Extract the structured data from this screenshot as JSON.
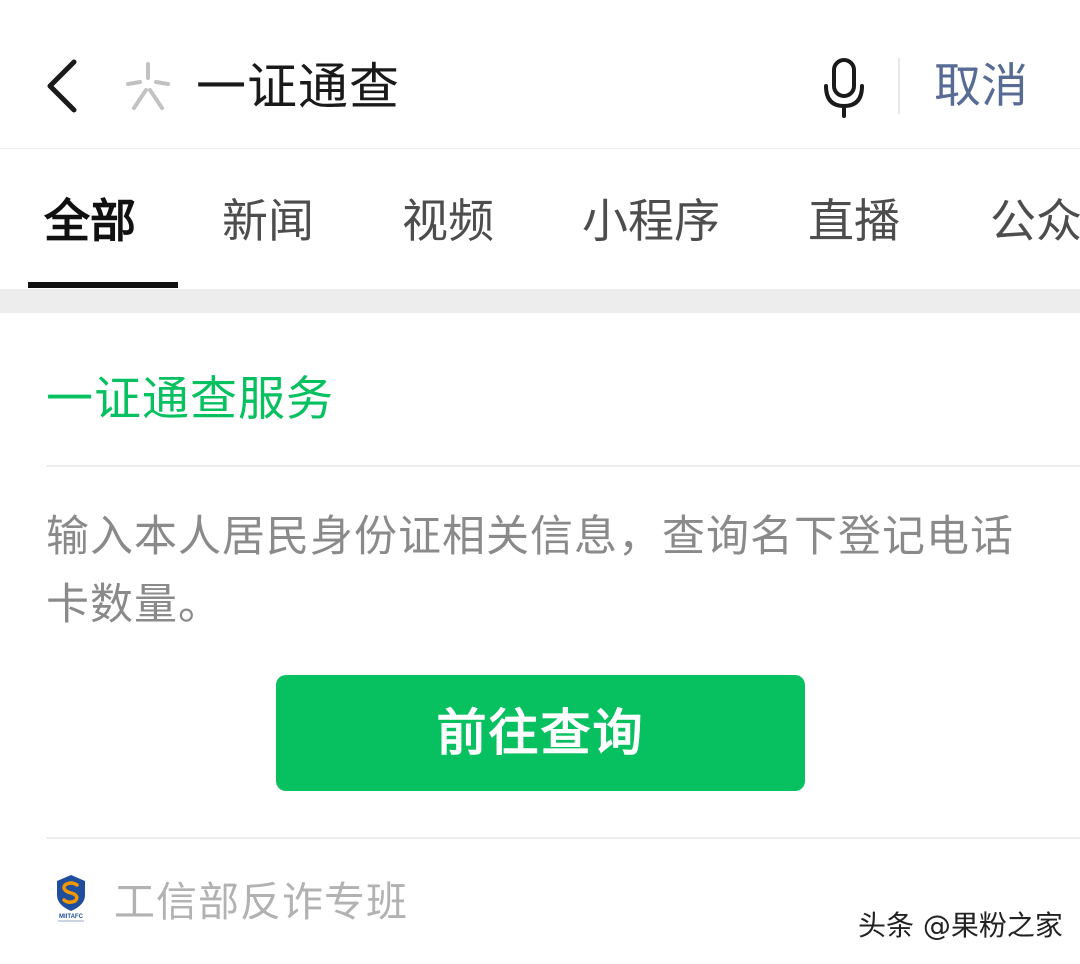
{
  "search": {
    "query": "一证通查",
    "cancel_label": "取消",
    "icons": {
      "back": "chevron-left-icon",
      "logo": "wechat-search-logo-icon",
      "mic": "microphone-icon"
    }
  },
  "tabs": [
    {
      "label": "全部",
      "active": true
    },
    {
      "label": "新闻",
      "active": false
    },
    {
      "label": "视频",
      "active": false
    },
    {
      "label": "小程序",
      "active": false
    },
    {
      "label": "直播",
      "active": false
    },
    {
      "label": "公众号",
      "active": false
    }
  ],
  "service_card": {
    "title": "一证通查服务",
    "description": "输入本人居民身份证相关信息，查询名下登记电话卡数量。",
    "button_label": "前往查询",
    "source": {
      "logo_text": "MIITAFC",
      "name": "工信部反诈专班"
    }
  },
  "watermark": "头条 @果粉之家",
  "colors": {
    "accent_green": "#07c160",
    "link_blue": "#576b95",
    "page_gap": "#ededed"
  }
}
